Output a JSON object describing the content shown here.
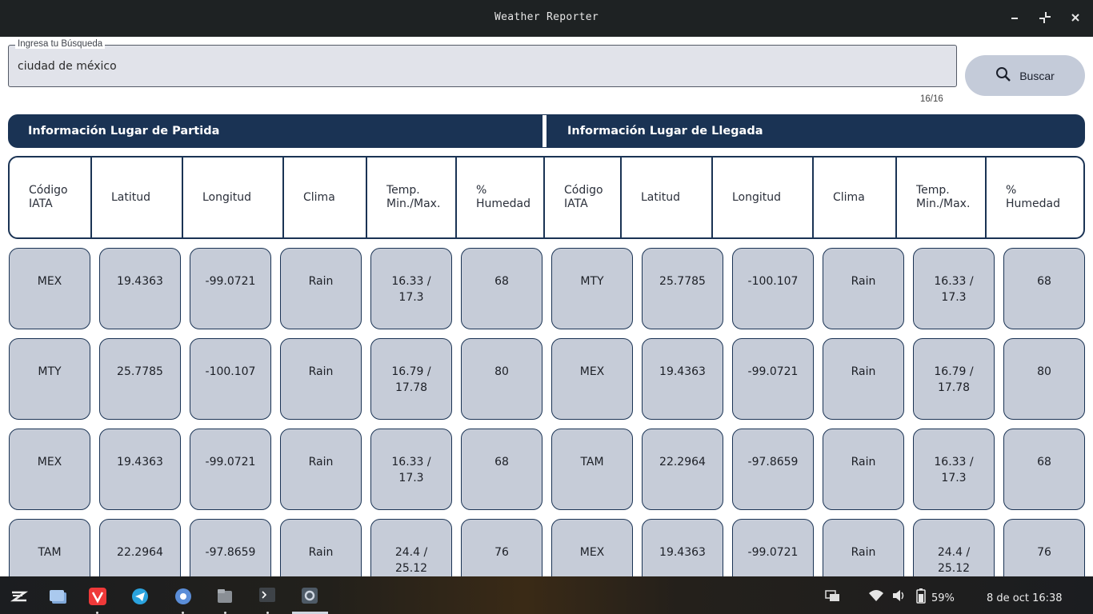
{
  "window": {
    "title": "Weather Reporter"
  },
  "search": {
    "label": "Ingresa tu Búsqueda",
    "value": "ciudad de méxico",
    "counter": "16/16",
    "button_label": "Buscar"
  },
  "sections": {
    "departure": "Información Lugar de Partida",
    "arrival": "Información Lugar de Llegada"
  },
  "columns": [
    [
      "Código",
      "IATA"
    ],
    [
      "Latitud"
    ],
    [
      "Longitud"
    ],
    [
      "Clima"
    ],
    [
      "Temp.",
      "Min./Max."
    ],
    [
      "%",
      "Humedad"
    ],
    [
      "Código",
      "IATA"
    ],
    [
      "Latitud"
    ],
    [
      "Longitud"
    ],
    [
      "Clima"
    ],
    [
      "Temp.",
      "Min./Max."
    ],
    [
      "%",
      "Humedad"
    ]
  ],
  "rows": [
    [
      "MEX",
      "19.4363",
      "-99.0721",
      "Rain",
      "16.33 / 17.3",
      "68",
      "MTY",
      "25.7785",
      "-100.107",
      "Rain",
      "16.33 / 17.3",
      "68"
    ],
    [
      "MTY",
      "25.7785",
      "-100.107",
      "Rain",
      "16.79 / 17.78",
      "80",
      "MEX",
      "19.4363",
      "-99.0721",
      "Rain",
      "16.79 / 17.78",
      "80"
    ],
    [
      "MEX",
      "19.4363",
      "-99.0721",
      "Rain",
      "16.33 / 17.3",
      "68",
      "TAM",
      "22.2964",
      "-97.8659",
      "Rain",
      "16.33 / 17.3",
      "68"
    ],
    [
      "TAM",
      "22.2964",
      "-97.8659",
      "Rain",
      "24.4 / 25.12",
      "76",
      "MEX",
      "19.4363",
      "-99.0721",
      "Rain",
      "24.4 / 25.12",
      "76"
    ]
  ],
  "taskbar": {
    "apps": [
      "zorin-menu-icon",
      "window-switcher-icon",
      "vivaldi-icon",
      "telegram-icon",
      "gnome-apps-icon",
      "files-icon",
      "terminal-icon",
      "settings-icon"
    ],
    "battery": "59%",
    "datetime": "8 de oct 16:38"
  },
  "colors": {
    "accent": "#1a3354",
    "cell_bg": "#c6ccd8",
    "search_bg": "#e1e3ea",
    "button_bg": "#c4cbd9"
  }
}
